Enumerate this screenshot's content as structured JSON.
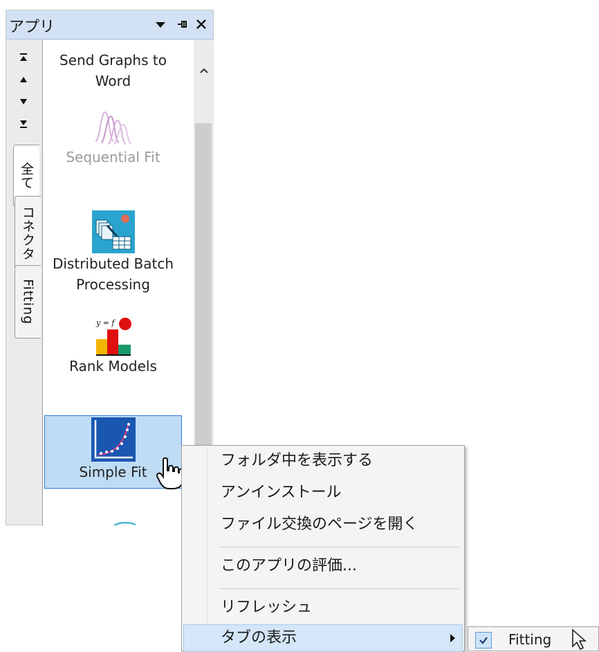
{
  "panel": {
    "title": "アプリ",
    "tabs": [
      {
        "label": "全て"
      },
      {
        "label": "コネクタ"
      },
      {
        "label": "Fitting"
      }
    ],
    "apps": [
      {
        "label": "Send Graphs to Word"
      },
      {
        "label": "Sequential Fit"
      },
      {
        "label": "Distributed Batch Processing"
      },
      {
        "label": "Rank Models"
      },
      {
        "label": "Simple Fit"
      }
    ]
  },
  "context_menu": {
    "items": [
      {
        "label": "フォルダ中を表示する"
      },
      {
        "label": "アンインストール"
      },
      {
        "label": "ファイル交換のページを開く"
      },
      {
        "label": "このアプリの評価..."
      },
      {
        "label": "リフレッシュ"
      },
      {
        "label": "タブの表示"
      }
    ],
    "submenu": {
      "label": "Fitting",
      "checked": true
    }
  }
}
